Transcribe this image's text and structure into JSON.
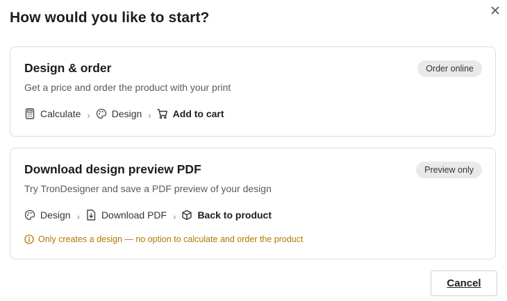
{
  "dialog": {
    "title": "How would you like to start?",
    "close_icon": "close-icon"
  },
  "options": [
    {
      "title": "Design & order",
      "badge": "Order online",
      "description": "Get a price and order the product with your print",
      "steps": [
        {
          "icon": "calculator-icon",
          "label": "Calculate"
        },
        {
          "icon": "palette-icon",
          "label": "Design"
        },
        {
          "icon": "cart-icon",
          "label": "Add to cart"
        }
      ]
    },
    {
      "title": "Download design preview PDF",
      "badge": "Preview only",
      "description": "Try TronDesigner and save a PDF preview of your design",
      "steps": [
        {
          "icon": "palette-icon",
          "label": "Design"
        },
        {
          "icon": "download-file-icon",
          "label": "Download PDF"
        },
        {
          "icon": "box-icon",
          "label": "Back to product"
        }
      ],
      "note": {
        "icon": "info-icon",
        "text": "Only creates a design — no option to calculate and order the product"
      }
    }
  ],
  "footer": {
    "cancel_label": "Cancel"
  },
  "colors": {
    "note_text": "#b07800",
    "badge_bg": "#e9e9e9",
    "card_border": "#dcdcdc"
  }
}
